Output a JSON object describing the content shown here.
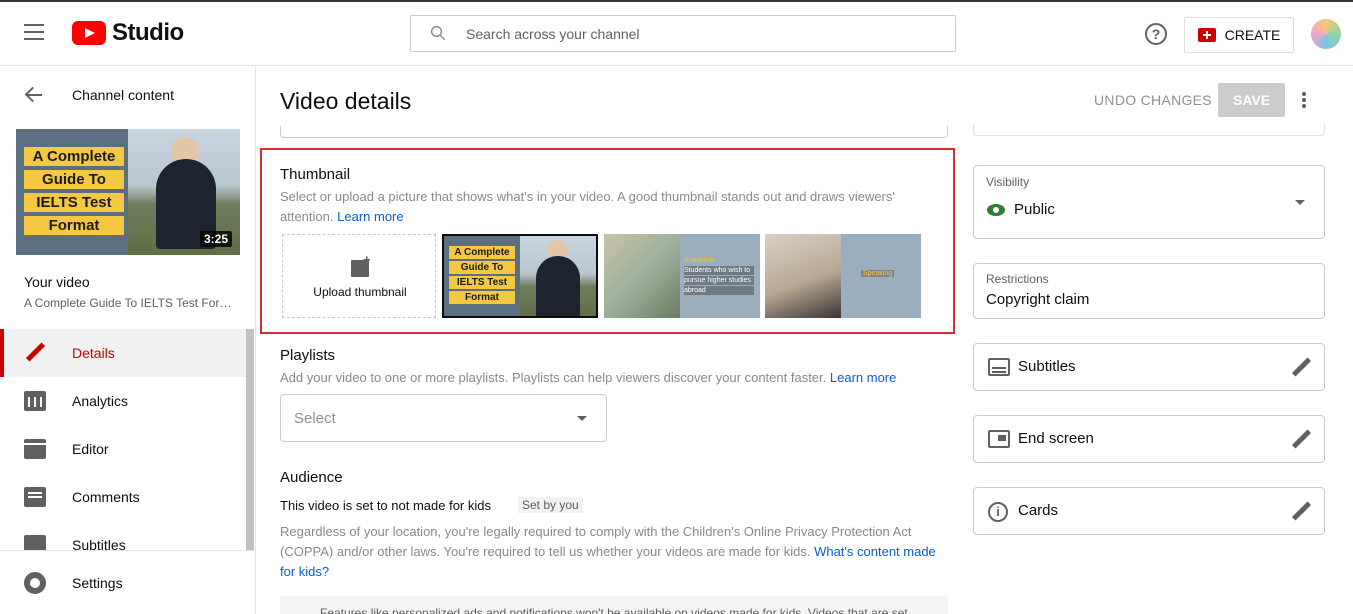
{
  "header": {
    "logo_text": "Studio",
    "search_placeholder": "Search across your channel",
    "create_label": "CREATE",
    "help_glyph": "?"
  },
  "sidebar": {
    "back_label": "Channel content",
    "thumbnail_lines": [
      "A Complete",
      "Guide To",
      "IELTS Test",
      "Format"
    ],
    "duration": "3:25",
    "your_video_label": "Your video",
    "video_title": "A Complete Guide To IELTS Test Format",
    "nav": [
      {
        "label": "Details",
        "icon": "pencil-icon",
        "active": true
      },
      {
        "label": "Analytics",
        "icon": "analytics-icon",
        "active": false
      },
      {
        "label": "Editor",
        "icon": "editor-icon",
        "active": false
      },
      {
        "label": "Comments",
        "icon": "comments-icon",
        "active": false
      },
      {
        "label": "Subtitles",
        "icon": "subtitles-icon",
        "active": false
      }
    ],
    "settings_label": "Settings"
  },
  "main": {
    "title": "Video details",
    "undo_label": "UNDO CHANGES",
    "save_label": "SAVE",
    "thumbnail": {
      "title": "Thumbnail",
      "desc": "Select or upload a picture that shows what's in your video. A good thumbnail stands out and draws viewers' attention.",
      "learn_more": "Learn more",
      "upload_label": "Upload thumbnail",
      "option1_lines": [
        "A Complete",
        "Guide To",
        "IELTS Test",
        "Format"
      ],
      "option2_heading": "Academic",
      "option2_lines": [
        "Students who wish to",
        "pursue higher studies",
        "abroad"
      ],
      "option3_heading": "Speaking"
    },
    "playlists": {
      "title": "Playlists",
      "desc": "Add your video to one or more playlists. Playlists can help viewers discover your content faster.",
      "learn_more": "Learn more",
      "select_label": "Select"
    },
    "audience": {
      "title": "Audience",
      "status": "This video is set to not made for kids",
      "badge": "Set by you",
      "desc": "Regardless of your location, you're legally required to comply with the Children's Online Privacy Protection Act (COPPA) and/or other laws. You're required to tell us whether your videos are made for kids.",
      "link": "What's content made for kids?",
      "notice": "Features like personalized ads and notifications won't be available on videos made for kids. Videos that are set"
    }
  },
  "right": {
    "visibility_label": "Visibility",
    "visibility_value": "Public",
    "restrictions_label": "Restrictions",
    "restrictions_value": "Copyright claim",
    "panels": [
      {
        "label": "Subtitles",
        "icon": "subtitles-icon"
      },
      {
        "label": "End screen",
        "icon": "end-screen-icon"
      },
      {
        "label": "Cards",
        "icon": "info-icon"
      }
    ]
  },
  "colors": {
    "accent": "#cc0000",
    "link": "#065fd4",
    "highlight_border": "#d32f2f",
    "public_green": "#2e7d32"
  }
}
